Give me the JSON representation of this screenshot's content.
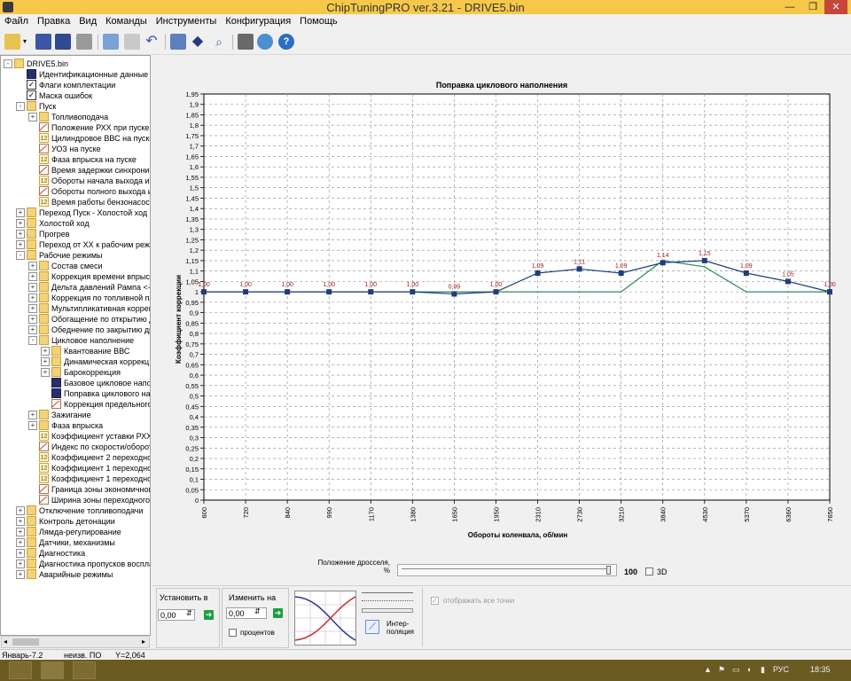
{
  "window": {
    "title": "ChipTuningPRO ver.3.21 - DRIVE5.bin",
    "controls": [
      "—",
      "❐",
      "✕"
    ]
  },
  "menu": [
    "Файл",
    "Правка",
    "Вид",
    "Команды",
    "Инструменты",
    "Конфигурация",
    "Помощь"
  ],
  "toolbar": [
    "open-icon",
    "dropdown-arrow-icon",
    "save-icon",
    "save-as-icon",
    "print-icon",
    "copy-icon",
    "paste-icon",
    "undo-icon",
    "chart-icon",
    "diamond-icon",
    "search-icon",
    "tools-icon",
    "globe-icon",
    "help-icon"
  ],
  "tree": [
    {
      "label": "DRIVE5.bin",
      "level": 0,
      "expander": "-",
      "icon": "folder"
    },
    {
      "label": "Идентификационные данные",
      "level": 1,
      "expander": "",
      "icon": "table"
    },
    {
      "label": "Флаги комплектации",
      "level": 1,
      "expander": "",
      "icon": "check"
    },
    {
      "label": "Маска ошибок",
      "level": 1,
      "expander": "",
      "icon": "check"
    },
    {
      "label": "Пуск",
      "level": 1,
      "expander": "-",
      "icon": "folder"
    },
    {
      "label": "Топливоподача",
      "level": 2,
      "expander": "+",
      "icon": "folder"
    },
    {
      "label": "Положение РХХ при пуске",
      "level": 2,
      "expander": "",
      "icon": "map2d"
    },
    {
      "label": "Цилиндровое ВВС на пуске",
      "level": 2,
      "expander": "",
      "icon": "ival"
    },
    {
      "label": "УОЗ на пуске",
      "level": 2,
      "expander": "",
      "icon": "map2d"
    },
    {
      "label": "Фаза впрыска на пуске",
      "level": 2,
      "expander": "",
      "icon": "ival"
    },
    {
      "label": "Время задержки синхрониз",
      "level": 2,
      "expander": "",
      "icon": "map2d"
    },
    {
      "label": "Обороты начала выхода из",
      "level": 2,
      "expander": "",
      "icon": "ival"
    },
    {
      "label": "Обороты полного выхода из",
      "level": 2,
      "expander": "",
      "icon": "map2d"
    },
    {
      "label": "Время работы бензонасоса",
      "level": 2,
      "expander": "",
      "icon": "ival"
    },
    {
      "label": "Переход Пуск - Холостой ход",
      "level": 1,
      "expander": "+",
      "icon": "folder"
    },
    {
      "label": "Холостой ход",
      "level": 1,
      "expander": "+",
      "icon": "folder"
    },
    {
      "label": "Прогрев",
      "level": 1,
      "expander": "+",
      "icon": "folder"
    },
    {
      "label": "Переход от ХХ к рабочим режи",
      "level": 1,
      "expander": "+",
      "icon": "folder"
    },
    {
      "label": "Рабочие режимы",
      "level": 1,
      "expander": "-",
      "icon": "folder"
    },
    {
      "label": "Состав смеси",
      "level": 2,
      "expander": "+",
      "icon": "folder"
    },
    {
      "label": "Коррекция времени впрыск",
      "level": 2,
      "expander": "+",
      "icon": "folder"
    },
    {
      "label": "Дельта давлений Рампа <->",
      "level": 2,
      "expander": "+",
      "icon": "folder"
    },
    {
      "label": "Коррекция по топливной пл",
      "level": 2,
      "expander": "+",
      "icon": "folder"
    },
    {
      "label": "Мультипликативная коррек",
      "level": 2,
      "expander": "+",
      "icon": "folder"
    },
    {
      "label": "Обогащение по открытию д",
      "level": 2,
      "expander": "+",
      "icon": "folder"
    },
    {
      "label": "Обеднение по закрытию др",
      "level": 2,
      "expander": "+",
      "icon": "folder"
    },
    {
      "label": "Цикловое наполнение",
      "level": 2,
      "expander": "-",
      "icon": "folder"
    },
    {
      "label": "Квантование ВВС",
      "level": 3,
      "expander": "+",
      "icon": "folder"
    },
    {
      "label": "Динамическая коррекц",
      "level": 3,
      "expander": "+",
      "icon": "folder"
    },
    {
      "label": "Барокоррекция",
      "level": 3,
      "expander": "+",
      "icon": "folder"
    },
    {
      "label": "Базовое цикловое напо",
      "level": 3,
      "expander": "",
      "icon": "table"
    },
    {
      "label": "Поправка циклового на",
      "level": 3,
      "expander": "",
      "icon": "table"
    },
    {
      "label": "Коррекция предельного",
      "level": 3,
      "expander": "",
      "icon": "map2d"
    },
    {
      "label": "Зажигание",
      "level": 2,
      "expander": "+",
      "icon": "folder"
    },
    {
      "label": "Фаза впрыска",
      "level": 2,
      "expander": "+",
      "icon": "folder"
    },
    {
      "label": "Коэффициент уставки РХХ",
      "level": 2,
      "expander": "",
      "icon": "ival"
    },
    {
      "label": "Индекс по скорости/оборот",
      "level": 2,
      "expander": "",
      "icon": "map2d"
    },
    {
      "label": "Коэффициент 2 переходног",
      "level": 2,
      "expander": "",
      "icon": "ival"
    },
    {
      "label": "Коэффициент 1 переходног",
      "level": 2,
      "expander": "",
      "icon": "ival"
    },
    {
      "label": "Коэффициент 1 переходног",
      "level": 2,
      "expander": "",
      "icon": "ival"
    },
    {
      "label": "Граница зоны экономичного",
      "level": 2,
      "expander": "",
      "icon": "map2d"
    },
    {
      "label": "Ширина зоны переходного р",
      "level": 2,
      "expander": "",
      "icon": "map2d"
    },
    {
      "label": "Отключение топливоподачи",
      "level": 1,
      "expander": "+",
      "icon": "folder"
    },
    {
      "label": "Контроль детонации",
      "level": 1,
      "expander": "+",
      "icon": "folder"
    },
    {
      "label": "Лямда-регулирование",
      "level": 1,
      "expander": "+",
      "icon": "folder"
    },
    {
      "label": "Датчики, механизмы",
      "level": 1,
      "expander": "+",
      "icon": "folder"
    },
    {
      "label": "Диагностика",
      "level": 1,
      "expander": "+",
      "icon": "folder"
    },
    {
      "label": "Диагностика пропусков воспла",
      "level": 1,
      "expander": "+",
      "icon": "folder"
    },
    {
      "label": "Аварийные режимы",
      "level": 1,
      "expander": "+",
      "icon": "folder"
    }
  ],
  "chart_data": {
    "type": "line",
    "title": "Поправка циклового наполнения",
    "xlabel": "Обороты коленвала, об/мин",
    "ylabel": "Коэффициент коррекции",
    "categories": [
      "600",
      "720",
      "840",
      "990",
      "1170",
      "1380",
      "1650",
      "1950",
      "2310",
      "2730",
      "3210",
      "3840",
      "4530",
      "5370",
      "6360",
      "7650"
    ],
    "ylim": [
      0,
      1.95
    ],
    "ytick_step": 0.05,
    "grid": true,
    "series": [
      {
        "values": [
          1.0,
          1.0,
          1.0,
          1.0,
          1.0,
          1.0,
          0.99,
          1.0,
          1.09,
          1.11,
          1.09,
          1.14,
          1.15,
          1.09,
          1.05,
          1.0
        ],
        "color": "#1f3e7a",
        "markers": true
      },
      {
        "values": [
          1.0,
          1.0,
          1.0,
          1.0,
          1.0,
          1.0,
          1.0,
          1.0,
          1.0,
          1.0,
          1.0,
          1.15,
          1.12,
          1.0,
          1.0,
          1.0
        ],
        "color": "#2e8b57",
        "markers": false
      }
    ],
    "data_labels": [
      "1,00",
      "1,00",
      "1,00",
      "1,00",
      "1,00",
      "1,00",
      "0,99",
      "1,00",
      "1,09",
      "1,11",
      "1,09",
      "1,14",
      "1,15",
      "1,09",
      "1,05",
      "1,00"
    ],
    "ytick_labels": [
      "0",
      "0,05",
      "0,1",
      "0,15",
      "0,2",
      "0,25",
      "0,3",
      "0,35",
      "0,4",
      "0,45",
      "0,5",
      "0,55",
      "0,6",
      "0,65",
      "0,7",
      "0,75",
      "0,8",
      "0,85",
      "0,9",
      "0,95",
      "1",
      "1,05",
      "1,1",
      "1,15",
      "1,2",
      "1,25",
      "1,3",
      "1,35",
      "1,4",
      "1,45",
      "1,5",
      "1,55",
      "1,6",
      "1,65",
      "1,7",
      "1,75",
      "1,8",
      "1,85",
      "1,9",
      "1,95"
    ]
  },
  "throttle": {
    "label_line1": "Положение дросселя,",
    "label_line2": "%",
    "value": "100",
    "level": 1.0,
    "label_3d": "3D"
  },
  "controls": {
    "set_label": "Установить в",
    "set_value": "0,00",
    "change_label": "Изменить на",
    "change_value": "0,00",
    "percent_label": "процентов",
    "interp_line1": "Интер-",
    "interp_line2": "поляция",
    "show_all_label": "отображать все точки"
  },
  "status": {
    "left": "Январь-7.2",
    "mid": "неизв. ПО",
    "right": "Y=2,064"
  },
  "taskbar": {
    "lang": "РУС",
    "time": "18:35"
  }
}
